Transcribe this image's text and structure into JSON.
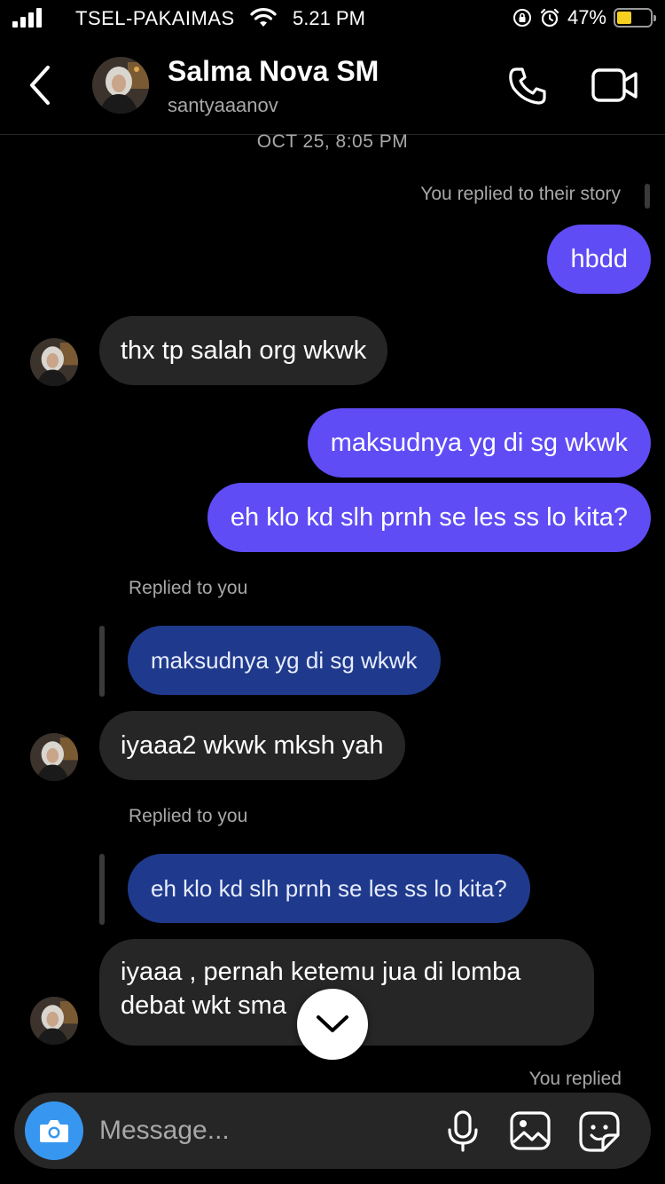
{
  "status_bar": {
    "carrier": "TSEL-PAKAIMAS",
    "time": "5.21 PM",
    "battery_percent": "47%",
    "battery_level": 0.47
  },
  "header": {
    "name": "Salma Nova SM",
    "username": "santyaaanov"
  },
  "conversation": {
    "timestamp": "OCT 25, 8:05 PM",
    "story_reply_label": "You replied to their story",
    "messages": [
      {
        "from": "me",
        "text": "hbdd"
      },
      {
        "from": "them",
        "text": "thx tp salah org wkwk"
      },
      {
        "from": "me",
        "text": "maksudnya yg di sg wkwk"
      },
      {
        "from": "me",
        "text": "eh klo kd slh prnh se les ss lo kita?"
      },
      {
        "from": "them",
        "reply_label": "Replied to you",
        "quoted": "maksudnya yg di sg wkwk",
        "text": "iyaaa2 wkwk mksh yah"
      },
      {
        "from": "them",
        "reply_label": "Replied to you",
        "quoted": "eh klo kd slh prnh se les ss lo kita?",
        "text_line1": "iyaaa , pernah ketemu jua di lomba",
        "text_line2": "debat wkt sma"
      }
    ],
    "you_replied_label": "You replied"
  },
  "composer": {
    "placeholder": "Message..."
  },
  "colors": {
    "outgoing_bubble": "#5f4cf5",
    "incoming_bubble": "#262626",
    "quoted_bubble": "#1f3a8c",
    "camera_button": "#3797f0"
  }
}
